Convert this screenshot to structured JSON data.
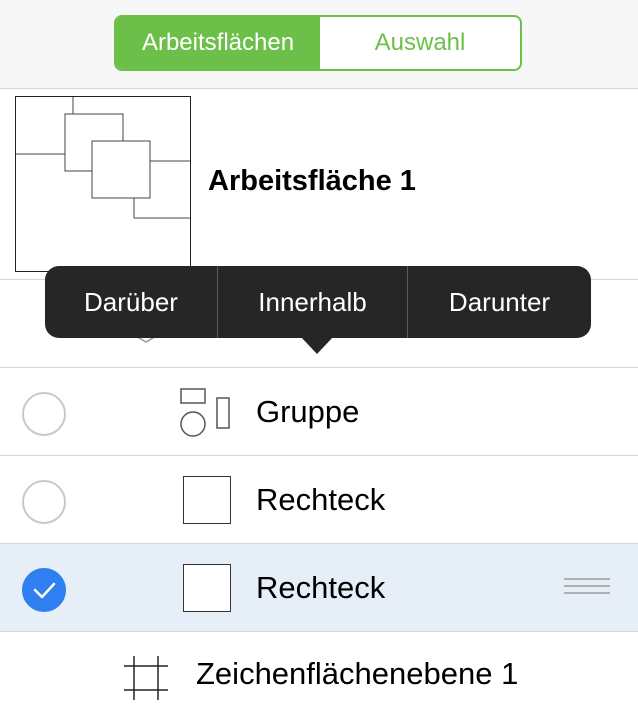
{
  "segmented": {
    "artboards_label": "Arbeitsflächen",
    "selection_label": "Auswahl",
    "active": "Arbeitsflächen"
  },
  "artboard": {
    "title": "Arbeitsfläche 1"
  },
  "context_menu": {
    "items": [
      "Darüber",
      "Innerhalb",
      "Darunter"
    ]
  },
  "layers": [
    {
      "label": "Gruppe",
      "icon": "group-icon",
      "selected": false
    },
    {
      "label": "Rechteck",
      "icon": "rectangle-icon",
      "selected": false
    },
    {
      "label": "Rechteck",
      "icon": "rectangle-icon",
      "selected": true
    }
  ],
  "footer": {
    "label": "Zeichenflächenebene 1",
    "icon": "artboard-layer-icon"
  },
  "colors": {
    "accent": "#6cc04a",
    "selection_blue": "#2f7ff0",
    "selected_row": "#e6eef8",
    "menu_bg": "#262626"
  }
}
